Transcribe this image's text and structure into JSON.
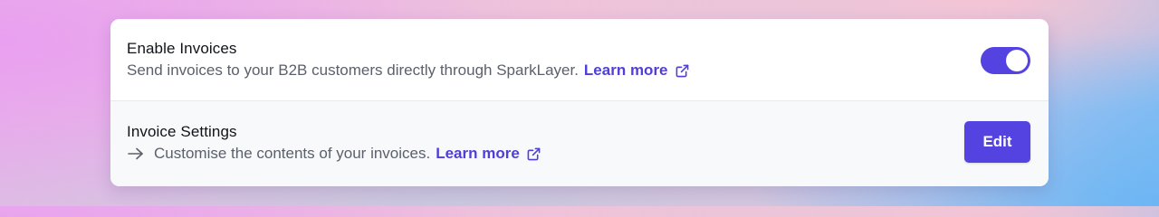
{
  "settings": {
    "invoices_toggle": {
      "title": "Enable Invoices",
      "description": "Send invoices to your B2B customers directly through SparkLayer.",
      "link_label": "Learn more",
      "enabled": true
    },
    "invoice_settings": {
      "title": "Invoice Settings",
      "description": "Customise the contents of your invoices.",
      "link_label": "Learn more",
      "button_label": "Edit"
    }
  },
  "colors": {
    "accent": "#5443e0",
    "link": "#4f3fd8",
    "title_text": "#111318",
    "body_text": "#5b606b",
    "card_background": "#ffffff",
    "alt_row_background": "#f7f9fb"
  },
  "icons": {
    "external_link": "external-link-icon",
    "arrow_right": "arrow-right-icon"
  }
}
